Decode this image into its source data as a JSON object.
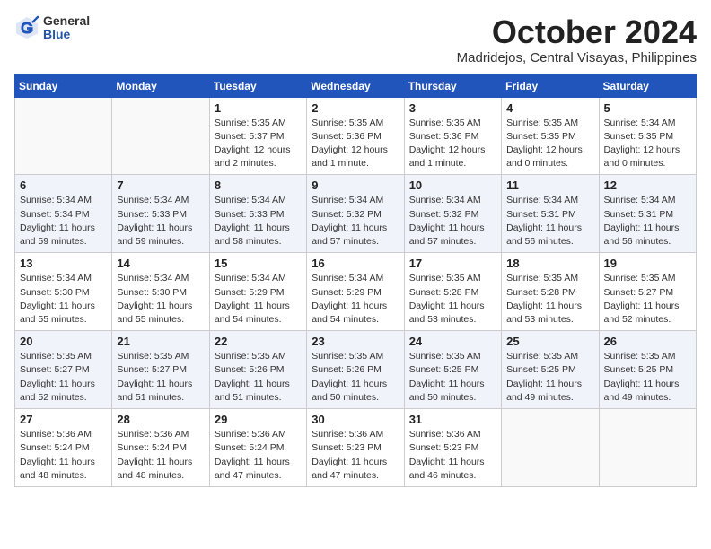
{
  "header": {
    "logo_general": "General",
    "logo_blue": "Blue",
    "month": "October 2024",
    "location": "Madridejos, Central Visayas, Philippines"
  },
  "weekdays": [
    "Sunday",
    "Monday",
    "Tuesday",
    "Wednesday",
    "Thursday",
    "Friday",
    "Saturday"
  ],
  "weeks": [
    [
      {
        "day": "",
        "info": ""
      },
      {
        "day": "",
        "info": ""
      },
      {
        "day": "1",
        "info": "Sunrise: 5:35 AM\nSunset: 5:37 PM\nDaylight: 12 hours\nand 2 minutes."
      },
      {
        "day": "2",
        "info": "Sunrise: 5:35 AM\nSunset: 5:36 PM\nDaylight: 12 hours\nand 1 minute."
      },
      {
        "day": "3",
        "info": "Sunrise: 5:35 AM\nSunset: 5:36 PM\nDaylight: 12 hours\nand 1 minute."
      },
      {
        "day": "4",
        "info": "Sunrise: 5:35 AM\nSunset: 5:35 PM\nDaylight: 12 hours\nand 0 minutes."
      },
      {
        "day": "5",
        "info": "Sunrise: 5:34 AM\nSunset: 5:35 PM\nDaylight: 12 hours\nand 0 minutes."
      }
    ],
    [
      {
        "day": "6",
        "info": "Sunrise: 5:34 AM\nSunset: 5:34 PM\nDaylight: 11 hours\nand 59 minutes."
      },
      {
        "day": "7",
        "info": "Sunrise: 5:34 AM\nSunset: 5:33 PM\nDaylight: 11 hours\nand 59 minutes."
      },
      {
        "day": "8",
        "info": "Sunrise: 5:34 AM\nSunset: 5:33 PM\nDaylight: 11 hours\nand 58 minutes."
      },
      {
        "day": "9",
        "info": "Sunrise: 5:34 AM\nSunset: 5:32 PM\nDaylight: 11 hours\nand 57 minutes."
      },
      {
        "day": "10",
        "info": "Sunrise: 5:34 AM\nSunset: 5:32 PM\nDaylight: 11 hours\nand 57 minutes."
      },
      {
        "day": "11",
        "info": "Sunrise: 5:34 AM\nSunset: 5:31 PM\nDaylight: 11 hours\nand 56 minutes."
      },
      {
        "day": "12",
        "info": "Sunrise: 5:34 AM\nSunset: 5:31 PM\nDaylight: 11 hours\nand 56 minutes."
      }
    ],
    [
      {
        "day": "13",
        "info": "Sunrise: 5:34 AM\nSunset: 5:30 PM\nDaylight: 11 hours\nand 55 minutes."
      },
      {
        "day": "14",
        "info": "Sunrise: 5:34 AM\nSunset: 5:30 PM\nDaylight: 11 hours\nand 55 minutes."
      },
      {
        "day": "15",
        "info": "Sunrise: 5:34 AM\nSunset: 5:29 PM\nDaylight: 11 hours\nand 54 minutes."
      },
      {
        "day": "16",
        "info": "Sunrise: 5:34 AM\nSunset: 5:29 PM\nDaylight: 11 hours\nand 54 minutes."
      },
      {
        "day": "17",
        "info": "Sunrise: 5:35 AM\nSunset: 5:28 PM\nDaylight: 11 hours\nand 53 minutes."
      },
      {
        "day": "18",
        "info": "Sunrise: 5:35 AM\nSunset: 5:28 PM\nDaylight: 11 hours\nand 53 minutes."
      },
      {
        "day": "19",
        "info": "Sunrise: 5:35 AM\nSunset: 5:27 PM\nDaylight: 11 hours\nand 52 minutes."
      }
    ],
    [
      {
        "day": "20",
        "info": "Sunrise: 5:35 AM\nSunset: 5:27 PM\nDaylight: 11 hours\nand 52 minutes."
      },
      {
        "day": "21",
        "info": "Sunrise: 5:35 AM\nSunset: 5:27 PM\nDaylight: 11 hours\nand 51 minutes."
      },
      {
        "day": "22",
        "info": "Sunrise: 5:35 AM\nSunset: 5:26 PM\nDaylight: 11 hours\nand 51 minutes."
      },
      {
        "day": "23",
        "info": "Sunrise: 5:35 AM\nSunset: 5:26 PM\nDaylight: 11 hours\nand 50 minutes."
      },
      {
        "day": "24",
        "info": "Sunrise: 5:35 AM\nSunset: 5:25 PM\nDaylight: 11 hours\nand 50 minutes."
      },
      {
        "day": "25",
        "info": "Sunrise: 5:35 AM\nSunset: 5:25 PM\nDaylight: 11 hours\nand 49 minutes."
      },
      {
        "day": "26",
        "info": "Sunrise: 5:35 AM\nSunset: 5:25 PM\nDaylight: 11 hours\nand 49 minutes."
      }
    ],
    [
      {
        "day": "27",
        "info": "Sunrise: 5:36 AM\nSunset: 5:24 PM\nDaylight: 11 hours\nand 48 minutes."
      },
      {
        "day": "28",
        "info": "Sunrise: 5:36 AM\nSunset: 5:24 PM\nDaylight: 11 hours\nand 48 minutes."
      },
      {
        "day": "29",
        "info": "Sunrise: 5:36 AM\nSunset: 5:24 PM\nDaylight: 11 hours\nand 47 minutes."
      },
      {
        "day": "30",
        "info": "Sunrise: 5:36 AM\nSunset: 5:23 PM\nDaylight: 11 hours\nand 47 minutes."
      },
      {
        "day": "31",
        "info": "Sunrise: 5:36 AM\nSunset: 5:23 PM\nDaylight: 11 hours\nand 46 minutes."
      },
      {
        "day": "",
        "info": ""
      },
      {
        "day": "",
        "info": ""
      }
    ]
  ]
}
